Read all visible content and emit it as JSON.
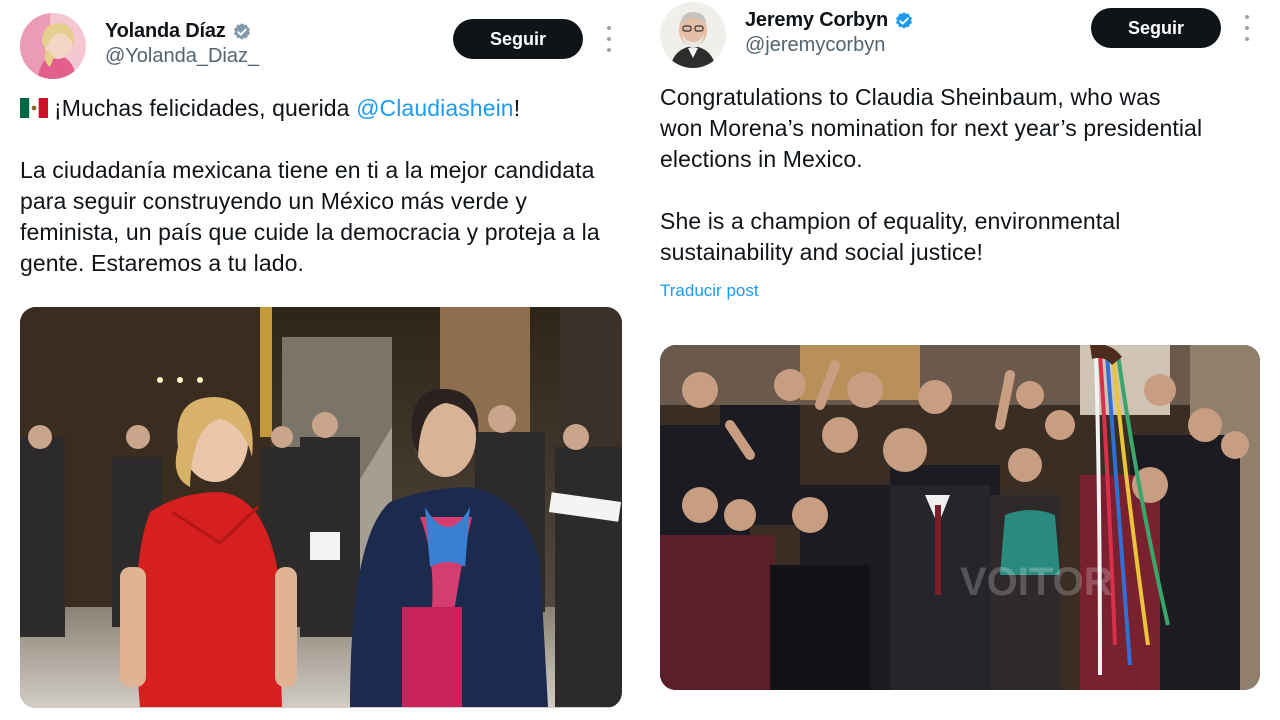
{
  "tweets": [
    {
      "author_name": "Yolanda Díaz",
      "handle": "@Yolanda_Diaz_",
      "follow_label": "Seguir",
      "text_prefix": "¡Muchas felicidades, querida ",
      "mention": "@Claudiashein",
      "text_suffix": "!",
      "paragraph_2": [
        "La ciudadanía mexicana tiene en ti a la mejor candidata",
        "para seguir construyendo un México más verde y",
        "feminista, un país que cuide la democracia y proteja a la",
        "gente. Estaremos a tu lado."
      ],
      "photo_icon": "photo-two-women-walking"
    },
    {
      "author_name": "Jeremy Corbyn",
      "handle": "@jeremycorbyn",
      "follow_label": "Seguir",
      "paragraph_1": [
        "Congratulations to Claudia Sheinbaum, who was",
        "won Morena’s nomination for next year’s presidential",
        "elections in Mexico."
      ],
      "paragraph_2": [
        "She is a champion of equality, environmental",
        "sustainability and social justice!"
      ],
      "translate_label": "Traducir post",
      "photo_icon": "photo-celebrating-crowd",
      "watermark": "VOITOR"
    }
  ],
  "colors": {
    "link": "#1d9bf0",
    "verified": "#1d9bf0",
    "button": "#0f1419",
    "text": "#0f1419",
    "secondary": "#536471"
  }
}
